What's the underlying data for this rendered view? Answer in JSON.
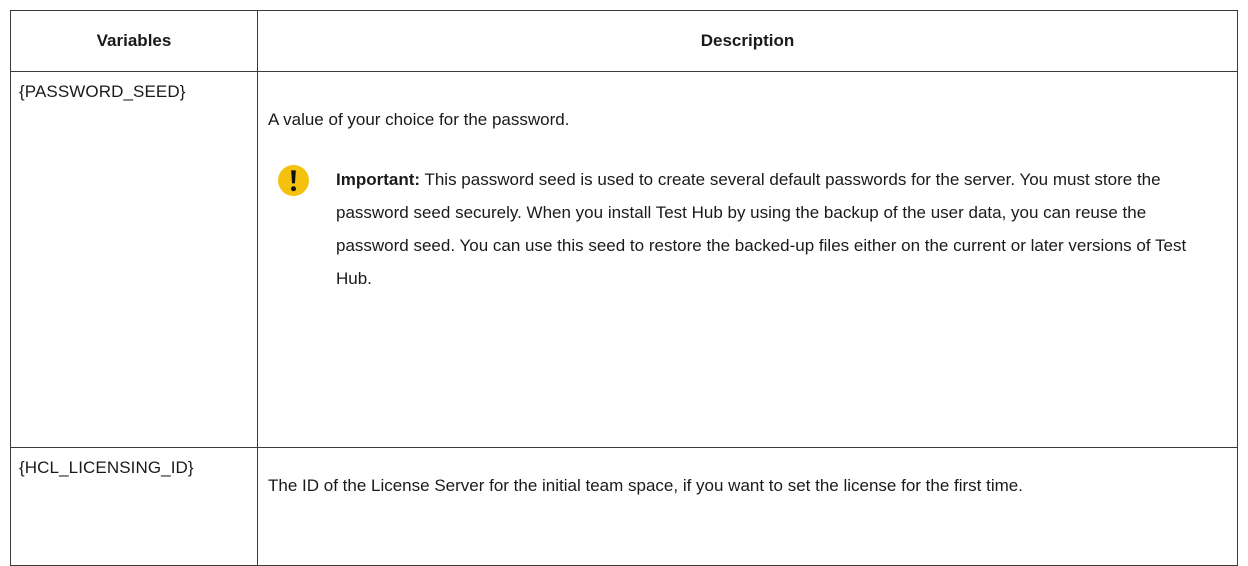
{
  "table": {
    "headers": {
      "variables": "Variables",
      "description": "Description"
    },
    "rows": [
      {
        "variable": "{PASSWORD_SEED}",
        "description": "A value of your choice for the password.",
        "note": {
          "icon": "exclamation-icon",
          "label": "Important:",
          "text": "This password seed is used to create several default passwords for the server. You must store the password seed securely. When you install Test Hub by using the backup of the user data, you can reuse the password seed. You can use this seed to restore the backed-up files either on the current or later versions of Test Hub."
        }
      },
      {
        "variable": "{HCL_LICENSING_ID}",
        "description": "The ID of the License Server for the initial team space, if you want to set the license for the first time."
      }
    ]
  },
  "colors": {
    "border": "#3a3a3a",
    "note_icon": "#f4c20d",
    "text": "#1a1a1a"
  }
}
